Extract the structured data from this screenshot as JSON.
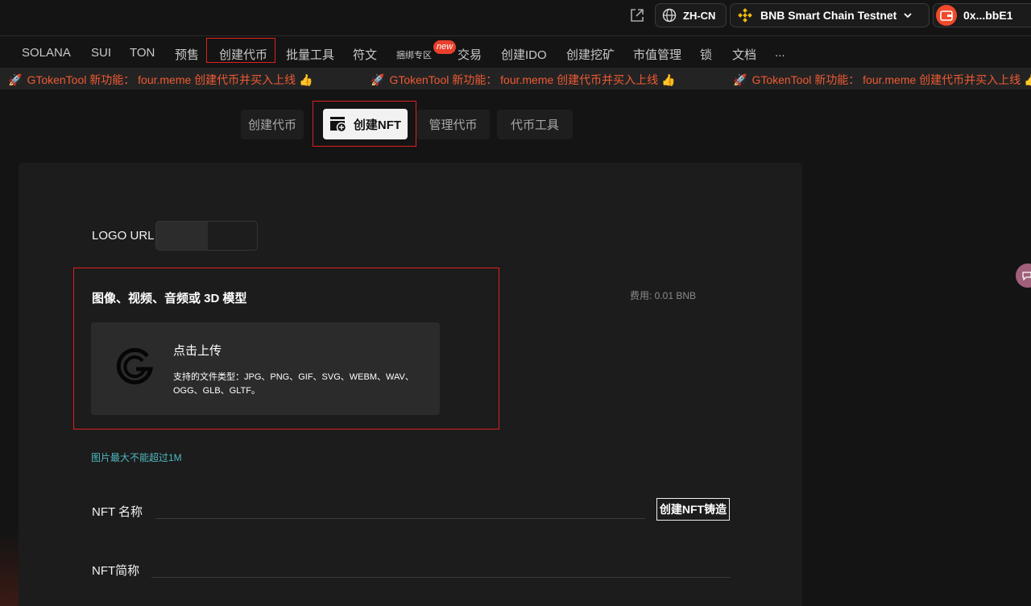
{
  "header": {
    "share_icon": "share-icon",
    "language": "ZH-CN",
    "chain": "BNB Smart Chain Testnet",
    "wallet": "0x...bbE1"
  },
  "nav": {
    "items": [
      "SOLANA",
      "SUI",
      "TON",
      "预售",
      "创建代币",
      "批量工具",
      "符文",
      "捆绑专区",
      "交易",
      "创建IDO",
      "创建挖矿",
      "市值管理",
      "锁",
      "文档",
      "..."
    ],
    "badge": "new"
  },
  "ticker": {
    "text": "GTokenTool 新功能： four.meme 创建代币并买入上线 👍"
  },
  "tabs": {
    "create_token": "创建代币",
    "create_nft": "创建NFT",
    "manage_token": "管理代币",
    "token_tools": "代币工具"
  },
  "form": {
    "logo_url_label": "LOGO URL",
    "upload_title": "图像、视频、音频或 3D 模型",
    "fee": "费用: 0.01 BNB",
    "upload_cta": "点击上传",
    "upload_formats": "支持的文件类型：JPG、PNG、GIF、SVG、WEBM、WAV、OGG、GLB、GLTF。",
    "size_hint": "图片最大不能超过1M",
    "nft_name_label": "NFT 名称",
    "nft_symbol_label": "NFT简称",
    "mint_button": "创建NFT铸造"
  },
  "colors": {
    "accent_red": "#e0201f",
    "ticker_orange": "#ef5a33",
    "hint_teal": "#4fb8c0",
    "badge_red": "#e8402d"
  }
}
